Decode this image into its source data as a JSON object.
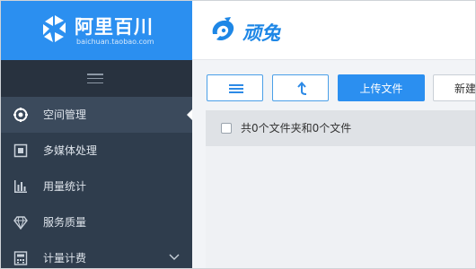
{
  "brand": {
    "title": "阿里百川",
    "subtitle": "baichuan.taobao.com",
    "logo_icon": "pinwheel-logo-icon",
    "bg_color": "#2b8ff0"
  },
  "sidebar": {
    "toggle_icon": "hamburger-icon",
    "bg_color": "#2f3d4d",
    "items": [
      {
        "label": "空间管理",
        "icon": "cube-settings-icon",
        "active": true
      },
      {
        "label": "多媒体处理",
        "icon": "media-processing-icon",
        "active": false
      },
      {
        "label": "用量统计",
        "icon": "bar-chart-icon",
        "active": false
      },
      {
        "label": "服务质量",
        "icon": "diamond-icon",
        "active": false
      },
      {
        "label": "计量计费",
        "icon": "calculator-icon",
        "active": false,
        "expandable": true
      }
    ]
  },
  "header": {
    "app_name": "顽兔",
    "app_logo": "wantu-logo-icon",
    "accent_color": "#1e87e6"
  },
  "toolbar": {
    "list_view_icon": "list-view-icon",
    "go_up_icon": "arrow-up-return-icon",
    "upload_label": "上传文件",
    "new_label": "新建"
  },
  "file_list": {
    "summary": "共0个文件夹和0个文件"
  }
}
